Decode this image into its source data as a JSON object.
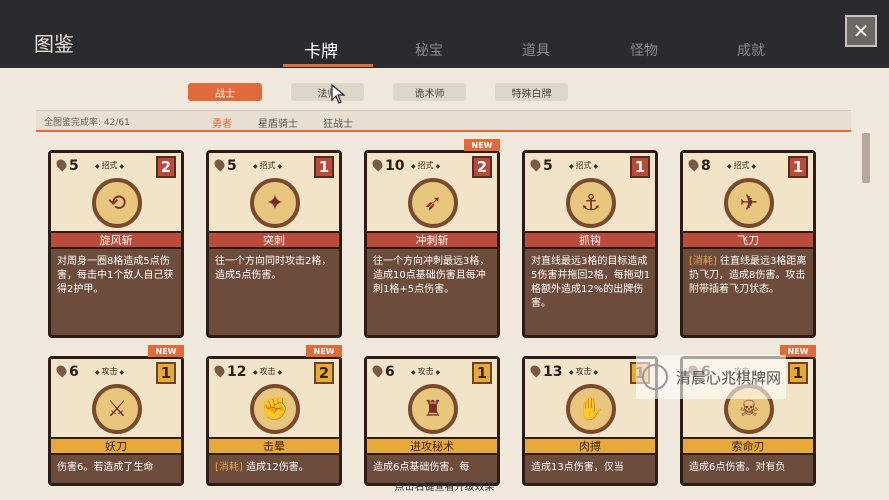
{
  "header": {
    "title": "图鉴",
    "tabs": [
      {
        "label": "卡牌",
        "active": true
      },
      {
        "label": "秘宝",
        "active": false
      },
      {
        "label": "道具",
        "active": false
      },
      {
        "label": "怪物",
        "active": false
      },
      {
        "label": "成就",
        "active": false
      }
    ],
    "close_label": "✕"
  },
  "filters": [
    {
      "label": "战士",
      "active": true
    },
    {
      "label": "法师",
      "active": false
    },
    {
      "label": "诡术师",
      "active": false
    },
    {
      "label": "特殊白牌",
      "active": false
    }
  ],
  "subbar": {
    "completion": "全图鉴完成率: 42/61",
    "subtabs": [
      {
        "label": "勇者",
        "active": true
      },
      {
        "label": "星盾骑士",
        "active": false
      },
      {
        "label": "狂战士",
        "active": false
      }
    ]
  },
  "cards": [
    {
      "cost": "5",
      "kind": "招式",
      "level": "2",
      "name": "旋风斩",
      "desc": "对周身一圈8格造成5点伤害，每击中1个敌人自己获得2护甲。",
      "new": "",
      "gold": false
    },
    {
      "cost": "5",
      "kind": "招式",
      "level": "1",
      "name": "突刺",
      "desc": "往一个方向同时攻击2格，造成5点伤害。",
      "new": "",
      "gold": false
    },
    {
      "cost": "10",
      "kind": "招式",
      "level": "2",
      "name": "冲刺斩",
      "desc": "往一个方向冲刺最远3格，造成10点基础伤害且每冲刺1格+5点伤害。",
      "new": "NEW",
      "gold": false
    },
    {
      "cost": "5",
      "kind": "招式",
      "level": "1",
      "name": "抓钩",
      "desc": "对直线最远3格的目标造成5伤害并拖回2格，每拖动1格额外造成12%的出牌伤害。",
      "new": "",
      "gold": false
    },
    {
      "cost": "8",
      "kind": "招式",
      "level": "1",
      "name": "飞刀",
      "desc_tag": "[消耗]",
      "desc": "往直线最远3格距离扔飞刀，造成8伤害。攻击附带插着飞刀状态。",
      "new": "",
      "gold": false
    },
    {
      "cost": "6",
      "kind": "攻击",
      "level": "1",
      "name": "妖刀",
      "desc": "伤害6。若造成了生命",
      "new": "NEW",
      "gold": true
    },
    {
      "cost": "12",
      "kind": "攻击",
      "level": "2",
      "name": "击晕",
      "desc_tag": "[消耗]",
      "desc": "造成12伤害。",
      "new": "NEW",
      "gold": true
    },
    {
      "cost": "6",
      "kind": "攻击",
      "level": "1",
      "name": "进攻秘术",
      "desc": "造成6点基础伤害。每",
      "new": "",
      "gold": true
    },
    {
      "cost": "13",
      "kind": "攻击",
      "level": "1",
      "name": "肉搏",
      "desc": "造成13点伤害，仅当",
      "new": "",
      "gold": true
    },
    {
      "cost": "6",
      "kind": "攻击",
      "level": "1",
      "name": "索命刃",
      "desc": "造成6点伤害。对有负",
      "new": "NEW",
      "gold": true
    }
  ],
  "footer": {
    "hint": "点击右键查看升级效果"
  },
  "watermark": {
    "text": "清晨心兆棋牌网"
  },
  "icons": [
    "close-icon",
    "cursor-icon",
    "drop-icon",
    "scroll-icon"
  ]
}
